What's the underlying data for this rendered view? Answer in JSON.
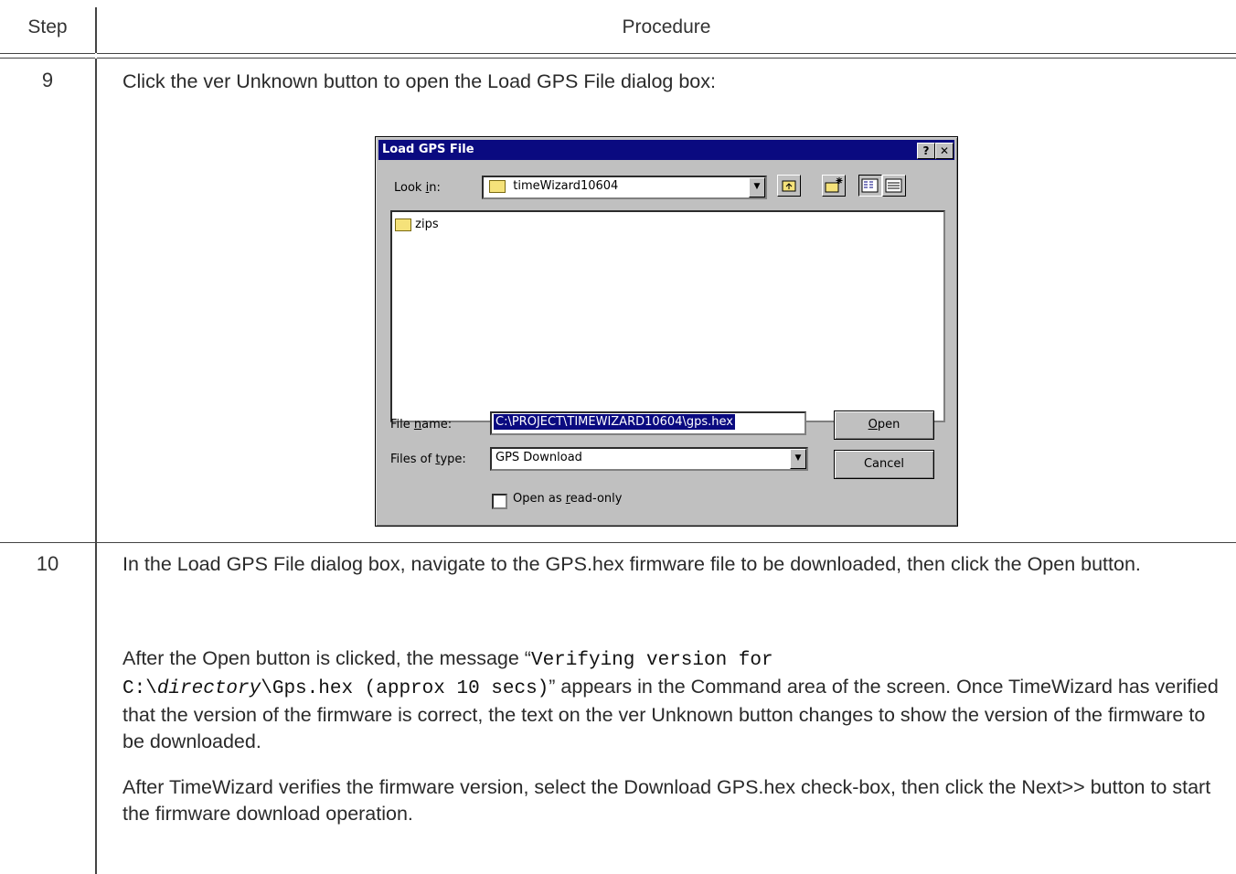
{
  "table": {
    "col_step": "Step",
    "col_procedure": "Procedure"
  },
  "steps": [
    {
      "num": "9",
      "text": "Click the ver Unknown button to open the Load GPS File dialog box:"
    },
    {
      "num": "10",
      "p1": "In the Load GPS File dialog box, navigate to the GPS.hex firmware file to be downloaded, then click the Open button.",
      "p2_a": "After the Open button is clicked, the message “",
      "p2_code1": "Verifying version for",
      "p2_code2a": "C:\\",
      "p2_code2_italic": "directory",
      "p2_code2b": "\\Gps.hex (approx 10 secs)",
      "p2_b": "” appears in the Command area of the screen. Once TimeWizard has verified that the version of the firmware is correct, the text on the ver Unknown button changes to show the version of the firmware to be downloaded.",
      "p3": "After TimeWizard verifies the firmware version, select the Download GPS.hex check-box, then click the Next>> button to start the firmware download operation."
    }
  ],
  "dialog": {
    "title": "Load GPS File",
    "help_btn": "?",
    "close_btn": "✕",
    "look_in_label_pre": "Look ",
    "look_in_label_u": "i",
    "look_in_label_post": "n:",
    "look_in_value": "timeWizard10604",
    "list_items": [
      "zips"
    ],
    "file_name_label_pre": "File ",
    "file_name_label_u": "n",
    "file_name_label_post": "ame:",
    "file_name_value": "C:\\PROJECT\\TIMEWIZARD10604\\gps.hex",
    "files_of_type_label_pre": "Files of ",
    "files_of_type_label_u": "t",
    "files_of_type_label_post": "ype:",
    "files_of_type_value": "GPS Download",
    "open_btn_u": "O",
    "open_btn_rest": "pen",
    "cancel_btn": "Cancel",
    "readonly_pre": "Open as ",
    "readonly_u": "r",
    "readonly_post": "ead-only",
    "readonly_checked": false
  }
}
